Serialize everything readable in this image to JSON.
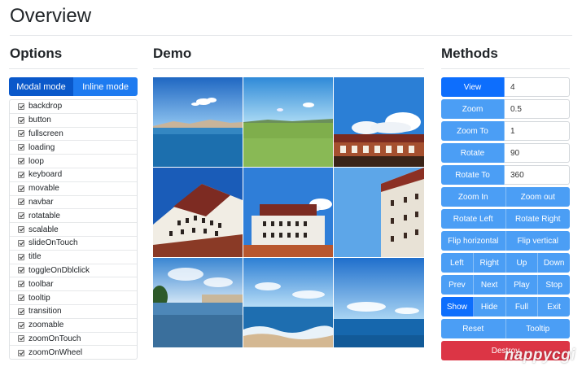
{
  "page": {
    "title": "Overview"
  },
  "sections": {
    "options": "Options",
    "demo": "Demo",
    "methods": "Methods"
  },
  "modes": [
    {
      "label": "Modal mode",
      "active": true
    },
    {
      "label": "Inline mode",
      "active": false
    }
  ],
  "options": [
    {
      "label": "backdrop",
      "checked": true
    },
    {
      "label": "button",
      "checked": true
    },
    {
      "label": "fullscreen",
      "checked": true
    },
    {
      "label": "loading",
      "checked": true
    },
    {
      "label": "loop",
      "checked": true
    },
    {
      "label": "keyboard",
      "checked": true
    },
    {
      "label": "movable",
      "checked": true
    },
    {
      "label": "navbar",
      "checked": true
    },
    {
      "label": "rotatable",
      "checked": true
    },
    {
      "label": "scalable",
      "checked": true
    },
    {
      "label": "slideOnTouch",
      "checked": true
    },
    {
      "label": "title",
      "checked": true
    },
    {
      "label": "toggleOnDblclick",
      "checked": true
    },
    {
      "label": "toolbar",
      "checked": true
    },
    {
      "label": "tooltip",
      "checked": true
    },
    {
      "label": "transition",
      "checked": true
    },
    {
      "label": "zoomable",
      "checked": true
    },
    {
      "label": "zoomOnTouch",
      "checked": true
    },
    {
      "label": "zoomOnWheel",
      "checked": true
    }
  ],
  "methods": {
    "inputs": [
      {
        "label": "View",
        "value": "4"
      },
      {
        "label": "Zoom",
        "value": "0.5"
      },
      {
        "label": "Zoom To",
        "value": "1"
      },
      {
        "label": "Rotate",
        "value": "90"
      },
      {
        "label": "Rotate To",
        "value": "360"
      }
    ],
    "button_rows": [
      [
        "Zoom In",
        "Zoom out"
      ],
      [
        "Rotate Left",
        "Rotate Right"
      ],
      [
        "Flip horizontal",
        "Flip vertical"
      ],
      [
        "Left",
        "Right",
        "Up",
        "Down"
      ],
      [
        "Prev",
        "Next",
        "Play",
        "Stop"
      ],
      [
        "Show",
        "Hide",
        "Full",
        "Exit"
      ],
      [
        "Reset",
        "Tooltip"
      ]
    ],
    "destroy": "Destroy"
  },
  "colors": {
    "primary": "#0d6efd",
    "button": "#4b9ef5",
    "danger": "#dc3545"
  },
  "watermark": "nappycgi"
}
